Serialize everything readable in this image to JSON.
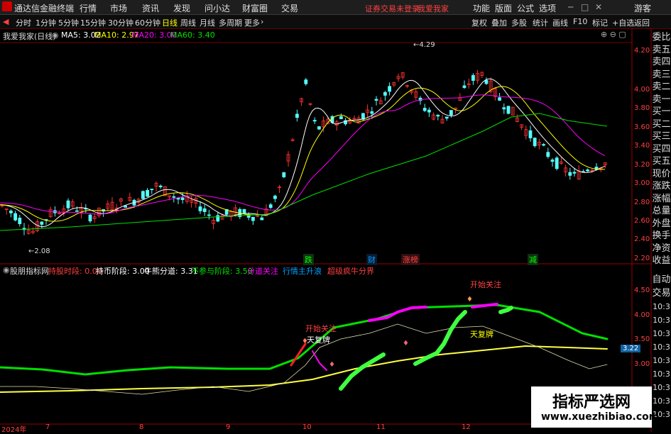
{
  "app_title": "通达信金融终端",
  "menu": [
    "行情",
    "市场",
    "资讯",
    "发现",
    "问小达",
    "财富圈",
    "交易"
  ],
  "trade_status": "证券交易未登录",
  "stock_name": "我爱我家",
  "menu_right": [
    "功能",
    "版面",
    "公式",
    "选项"
  ],
  "guest": "游客",
  "periods": [
    "分时",
    "1分钟",
    "5分钟",
    "15分钟",
    "30分钟",
    "60分钟",
    "日线",
    "周线",
    "月线",
    "多周期",
    "更多"
  ],
  "active_period": "日线",
  "tools": [
    "复权",
    "叠加",
    "多股",
    "统计",
    "画线",
    "F10",
    "标记",
    "+自选",
    "返回"
  ],
  "main_title": "我爱我家(日线)",
  "ma": [
    {
      "label": "MA5: 3.02",
      "color": "#ffffff"
    },
    {
      "label": "MA10: 2.97",
      "color": "#ffff00"
    },
    {
      "label": "MA20: 3.00",
      "color": "#ff00ff"
    },
    {
      "label": "MA60: 3.40",
      "color": "#00e000"
    }
  ],
  "price_axis": [
    "4.20",
    "4.00",
    "3.80",
    "3.60",
    "3.40",
    "3.20",
    "3.00",
    "2.80",
    "2.60",
    "2.40",
    "2.20"
  ],
  "high_label": "4.29",
  "low_label": "2.08",
  "event_tags": [
    {
      "text": "跌",
      "color": "#00ff00"
    },
    {
      "text": "财",
      "color": "#00a0ff"
    },
    {
      "text": "涨榜",
      "color": "#ff4040"
    },
    {
      "text": "减",
      "color": "#00ff00"
    }
  ],
  "right_panel": [
    "委比",
    "卖五",
    "卖四",
    "卖三",
    "卖二",
    "卖一",
    "买一",
    "买二",
    "买三",
    "买四",
    "买五",
    "现价",
    "涨跌",
    "涨幅",
    "总量",
    "外盘",
    "换手",
    "净资",
    "收益"
  ],
  "right_panel_lower": [
    "自动",
    "交易",
    "10:3",
    "10:3",
    "10:3",
    "10:3",
    "10:3",
    "10:3",
    "10:3",
    "10:3",
    "10:3"
  ],
  "indicator": {
    "name": "股朋指标网",
    "items": [
      {
        "label": "持股时段: 0.00",
        "color": "#ff4040"
      },
      {
        "label": "持币阶段: 3.00",
        "color": "#ffffff"
      },
      {
        "label": "牛熊分道: 3.31",
        "color": "#ffffff"
      },
      {
        "label": "不参与阶段: 3.50",
        "color": "#00e000"
      },
      {
        "label": "分道关注",
        "color": "#ff00ff"
      },
      {
        "label": "行情主升浪",
        "color": "#00a0ff"
      },
      {
        "label": "超级疯牛分界",
        "color": "#ff4040"
      }
    ],
    "axis": [
      "4.50",
      "4.00",
      "3.50",
      "3.00"
    ],
    "current_value": "3.22",
    "annotations": {
      "watch1": "开始关注",
      "watch2": "开始关注",
      "sky1": "天复牌",
      "sky2": "天复牌"
    }
  },
  "date_axis": [
    "2024年",
    "7",
    "8",
    "9",
    "10",
    "11",
    "12"
  ],
  "watermark": {
    "title": "指标严选网",
    "url": "www.xuezhibiao.com"
  }
}
